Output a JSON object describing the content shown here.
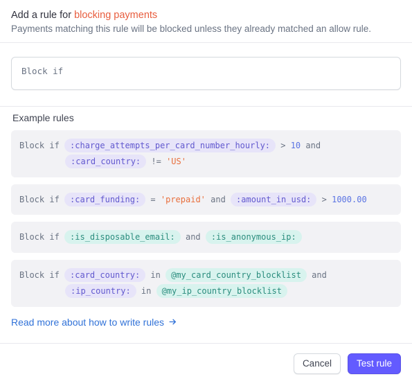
{
  "header": {
    "title_prefix": "Add a rule for ",
    "title_accent": "blocking payments",
    "subtitle": "Payments matching this rule will be blocked unless they already matched an allow rule."
  },
  "input": {
    "value": "Block if"
  },
  "examples": {
    "title": "Example rules",
    "rules": [
      {
        "prefix": "Block if ",
        "tokens_line1": [
          {
            "type": "attr",
            "text": ":charge_attempts_per_card_number_hourly:"
          },
          {
            "type": "kw",
            "text": " > "
          },
          {
            "type": "num",
            "text": "10"
          },
          {
            "type": "kw",
            "text": " and"
          }
        ],
        "tokens_line2": [
          {
            "type": "attr",
            "text": ":card_country:"
          },
          {
            "type": "kw",
            "text": " != "
          },
          {
            "type": "str",
            "text": "'US'"
          }
        ]
      },
      {
        "prefix": "Block if ",
        "tokens_line1": [
          {
            "type": "attr",
            "text": ":card_funding:"
          },
          {
            "type": "kw",
            "text": " = "
          },
          {
            "type": "str",
            "text": "'prepaid'"
          },
          {
            "type": "kw",
            "text": " and "
          },
          {
            "type": "attr",
            "text": ":amount_in_usd:"
          },
          {
            "type": "kw",
            "text": " > "
          },
          {
            "type": "num",
            "text": "1000.00"
          }
        ]
      },
      {
        "prefix": "Block if ",
        "tokens_line1": [
          {
            "type": "attr_teal",
            "text": ":is_disposable_email:"
          },
          {
            "type": "kw",
            "text": " and "
          },
          {
            "type": "attr_teal",
            "text": ":is_anonymous_ip:"
          }
        ]
      },
      {
        "prefix": "Block if ",
        "tokens_line1": [
          {
            "type": "attr",
            "text": ":card_country:"
          },
          {
            "type": "kw",
            "text": " in "
          },
          {
            "type": "list",
            "text": "@my_card_country_blocklist"
          },
          {
            "type": "kw",
            "text": " and"
          }
        ],
        "tokens_line2": [
          {
            "type": "attr",
            "text": ":ip_country:"
          },
          {
            "type": "kw",
            "text": " in "
          },
          {
            "type": "list",
            "text": "@my_ip_country_blocklist"
          }
        ]
      }
    ],
    "link_text": "Read more about how to write rules"
  },
  "footer": {
    "cancel": "Cancel",
    "test": "Test rule"
  }
}
